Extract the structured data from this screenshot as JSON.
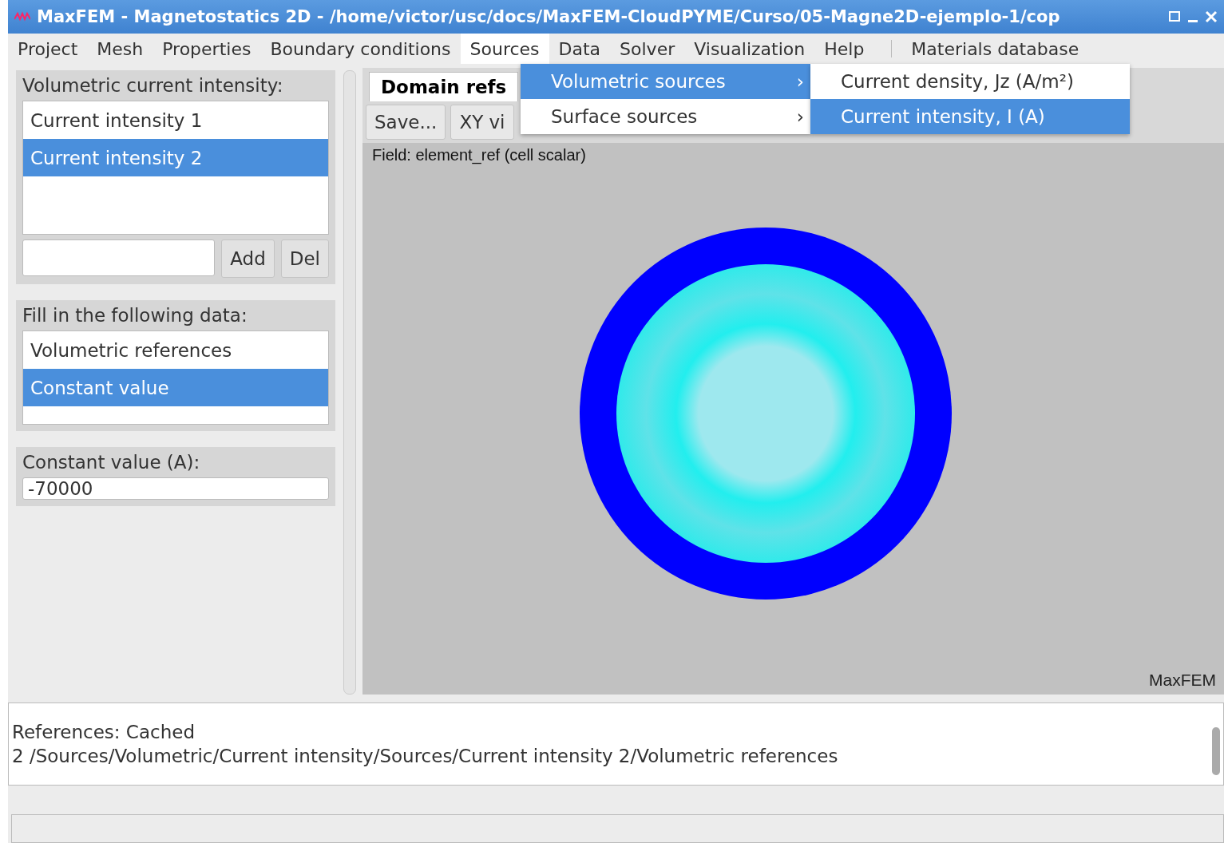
{
  "window": {
    "title": "MaxFEM - Magnetostatics 2D - /home/victor/usc/docs/MaxFEM-CloudPYME/Curso/05-Magne2D-ejemplo-1/cop"
  },
  "menu_bar": [
    {
      "label": "Project",
      "selected": false
    },
    {
      "label": "Mesh",
      "selected": false
    },
    {
      "label": "Properties",
      "selected": false
    },
    {
      "label": "Boundary conditions",
      "selected": false
    },
    {
      "label": "Sources",
      "selected": true
    },
    {
      "label": "Data",
      "selected": false
    },
    {
      "label": "Solver",
      "selected": false
    },
    {
      "label": "Visualization",
      "selected": false
    },
    {
      "label": "Help",
      "selected": false
    },
    {
      "label": "Materials database",
      "selected": false,
      "kind": "separated"
    }
  ],
  "dropdown": [
    {
      "label": "Volumetric sources",
      "selected": true,
      "arrow": "›"
    },
    {
      "label": "Surface sources",
      "selected": false,
      "arrow": "›"
    }
  ],
  "submenu": [
    {
      "label": "Current density, Jz (A/m²)",
      "selected": false
    },
    {
      "label": "Current intensity, I (A)",
      "selected": true
    }
  ],
  "left_panel": {
    "sources_group": {
      "title": "Volumetric current intensity:",
      "items": [
        {
          "label": "Current intensity 1",
          "selected": false
        },
        {
          "label": "Current intensity 2",
          "selected": true
        }
      ],
      "add": "Add",
      "del": "Del"
    },
    "data_group": {
      "title": "Fill in the following data:",
      "items": [
        {
          "label": "Volumetric references",
          "selected": false
        },
        {
          "label": "Constant value",
          "selected": true
        }
      ]
    },
    "value_group": {
      "title": "Constant value (A):",
      "value": "-70000"
    }
  },
  "viewer": {
    "tab": "Domain refs",
    "toolbar": [
      "Save...",
      "XY vi"
    ],
    "field_label": "Field: element_ref (cell scalar)",
    "brand": "MaxFEM"
  },
  "log": [
    "References: Cached",
    "2 /Sources/Volumetric/Current intensity/Sources/Current intensity 2/Volumetric references"
  ]
}
